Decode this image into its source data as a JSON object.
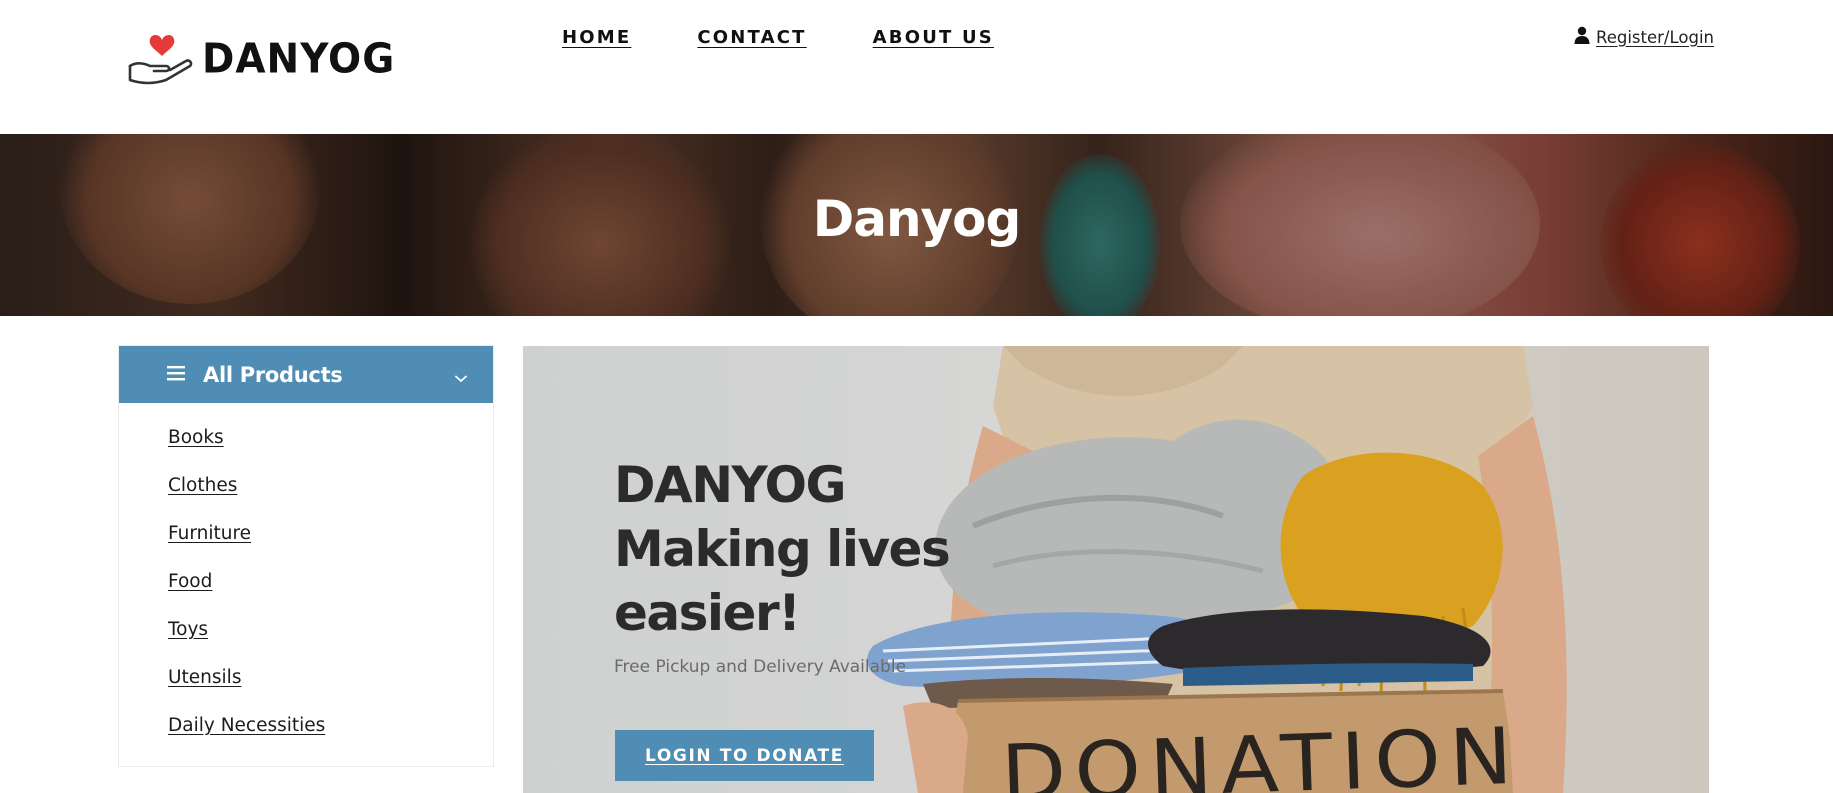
{
  "header": {
    "logo_text": "DANYOG",
    "nav": [
      "HOME",
      "CONTACT",
      "ABOUT US"
    ],
    "account_link": "Register/Login"
  },
  "banner": {
    "title": "Danyog"
  },
  "sidebar": {
    "title": "All Products",
    "categories": [
      "Books",
      "Clothes",
      "Furniture",
      "Food",
      "Toys",
      "Utensils",
      "Daily Necessities"
    ]
  },
  "promo": {
    "title_lines": [
      "DANYOG",
      "Making lives",
      "easier!"
    ],
    "subtitle": "Free Pickup and Delivery Available",
    "button_label": "LOGIN TO DONATE",
    "box_label": "DONATION"
  },
  "colors": {
    "accent": "#4f8db5",
    "heart": "#e63a3a",
    "text_dark": "#1c1c1c"
  },
  "icons": {
    "logo": "heart-hand-icon",
    "account": "user-icon",
    "menu": "hamburger-icon",
    "dropdown": "chevron-down-icon"
  }
}
